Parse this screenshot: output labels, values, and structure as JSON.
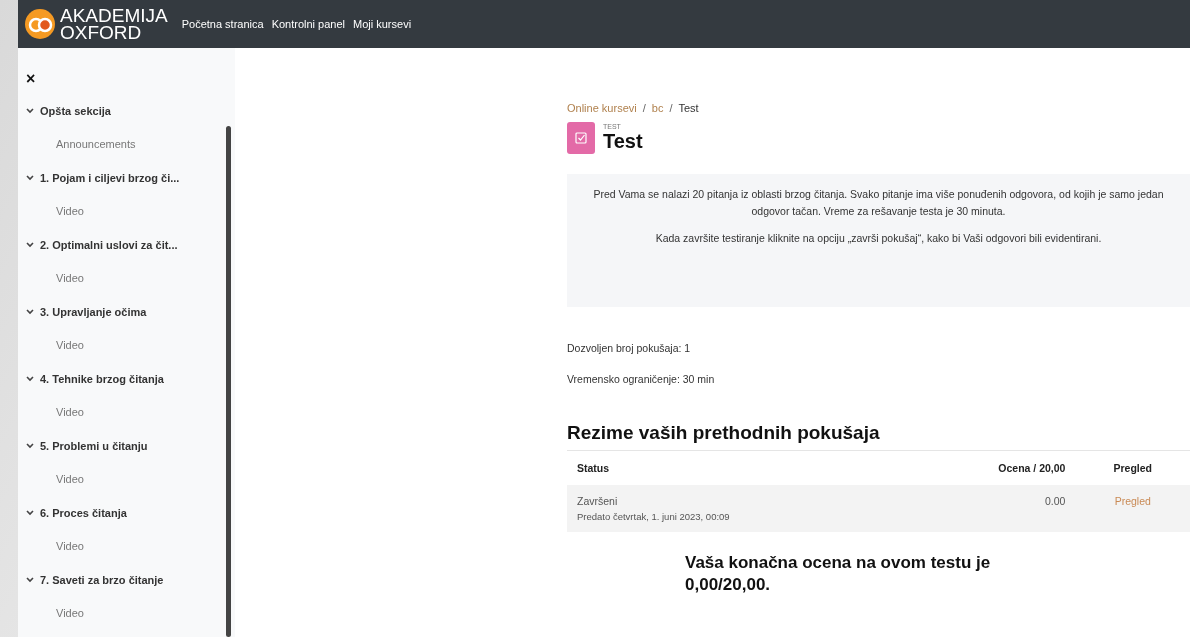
{
  "header": {
    "logo_line1": "AKADEMIJA",
    "logo_line2": "OXFORD",
    "nav": [
      {
        "label": "Početna stranica"
      },
      {
        "label": "Kontrolni panel"
      },
      {
        "label": "Moji kursevi"
      }
    ]
  },
  "sidebar": {
    "close": "×",
    "sections": [
      {
        "title": "Opšta sekcija",
        "expanded": true,
        "children": [
          {
            "label": "Announcements"
          }
        ]
      },
      {
        "title": "1. Pojam i ciljevi brzog či...",
        "expanded": true,
        "children": [
          {
            "label": "Video"
          }
        ]
      },
      {
        "title": "2. Optimalni uslovi za čit...",
        "expanded": true,
        "children": [
          {
            "label": "Video"
          }
        ]
      },
      {
        "title": "3. Upravljanje očima",
        "expanded": true,
        "children": [
          {
            "label": "Video"
          }
        ]
      },
      {
        "title": "4. Tehnike brzog čitanja",
        "expanded": true,
        "children": [
          {
            "label": "Video"
          }
        ]
      },
      {
        "title": "5. Problemi u čitanju",
        "expanded": true,
        "children": [
          {
            "label": "Video"
          }
        ]
      },
      {
        "title": "6. Proces čitanja",
        "expanded": true,
        "children": [
          {
            "label": "Video"
          }
        ]
      },
      {
        "title": "7. Saveti za brzo čitanje",
        "expanded": true,
        "children": [
          {
            "label": "Video"
          }
        ]
      }
    ]
  },
  "breadcrumb": [
    {
      "label": "Online kursevi",
      "link": true
    },
    {
      "label": "bc",
      "link": true
    },
    {
      "label": "Test",
      "link": false
    }
  ],
  "breadcrumb_separator": "/",
  "activity": {
    "type_label": "TEST",
    "title": "Test"
  },
  "intro": [
    "Pred Vama se nalazi 20 pitanja iz oblasti brzog čitanja. Svako pitanje ima više ponuđenih odgovora, od kojih je samo jedan odgovor tačan. Vreme za rešavanje testa je 30 minuta.",
    "Kada završite testiranje kliknite na opciju „završi pokušaj“, kako bi Vaši odgovori bili evidentirani."
  ],
  "info": [
    "Dozvoljen broj pokušaja: 1",
    "Vremensko ograničenje: 30 min"
  ],
  "summary": {
    "heading": "Rezime vaših prethodnih pokušaja",
    "columns": [
      "Status",
      "Ocena / 20,00",
      "Pregled"
    ],
    "rows": [
      {
        "status": "Završeni",
        "submitted": "Predato četvrtak, 1. juni 2023, 00:09",
        "grade": "0.00",
        "review": "Pregled"
      }
    ]
  },
  "final_grade": "Vaša konačna ocena na ovom testu je 0,00/20,00."
}
